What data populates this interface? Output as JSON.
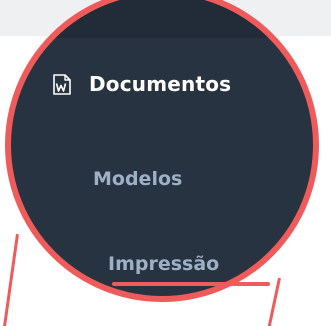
{
  "sidebar": {
    "section": {
      "icon": "word-document-icon",
      "label": "Documentos"
    },
    "items": [
      {
        "label": "Modelos"
      },
      {
        "label": "Impressão"
      }
    ]
  },
  "colors": {
    "sidebar_background": "#283341",
    "highlight": "#ef5a5a",
    "section_label": "#ffffff",
    "item_label": "#9eb0c6"
  }
}
